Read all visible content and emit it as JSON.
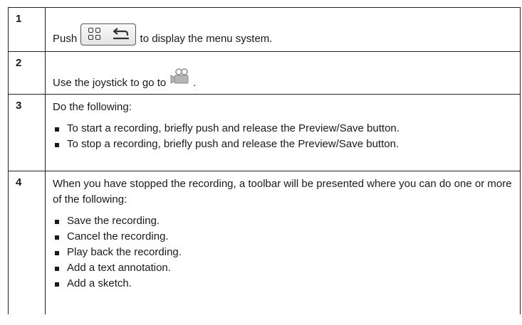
{
  "steps": [
    {
      "number": "1",
      "text_before": "Push",
      "icon": "menu-back-button-icon",
      "text_after": "to display the menu system."
    },
    {
      "number": "2",
      "text_before": "Use the joystick to go to",
      "icon": "video-camera-icon",
      "text_after": "."
    },
    {
      "number": "3",
      "intro": "Do the following:",
      "bullets": [
        "To start a recording, briefly push and release the Preview/Save button.",
        "To stop a recording, briefly push and release the Preview/Save button."
      ]
    },
    {
      "number": "4",
      "intro": "When you have stopped the recording, a toolbar will be presented where you can do one or more of the following:",
      "bullets": [
        "Save the recording.",
        "Cancel the recording.",
        "Play back the recording.",
        "Add a text annotation.",
        "Add a sketch."
      ]
    }
  ]
}
